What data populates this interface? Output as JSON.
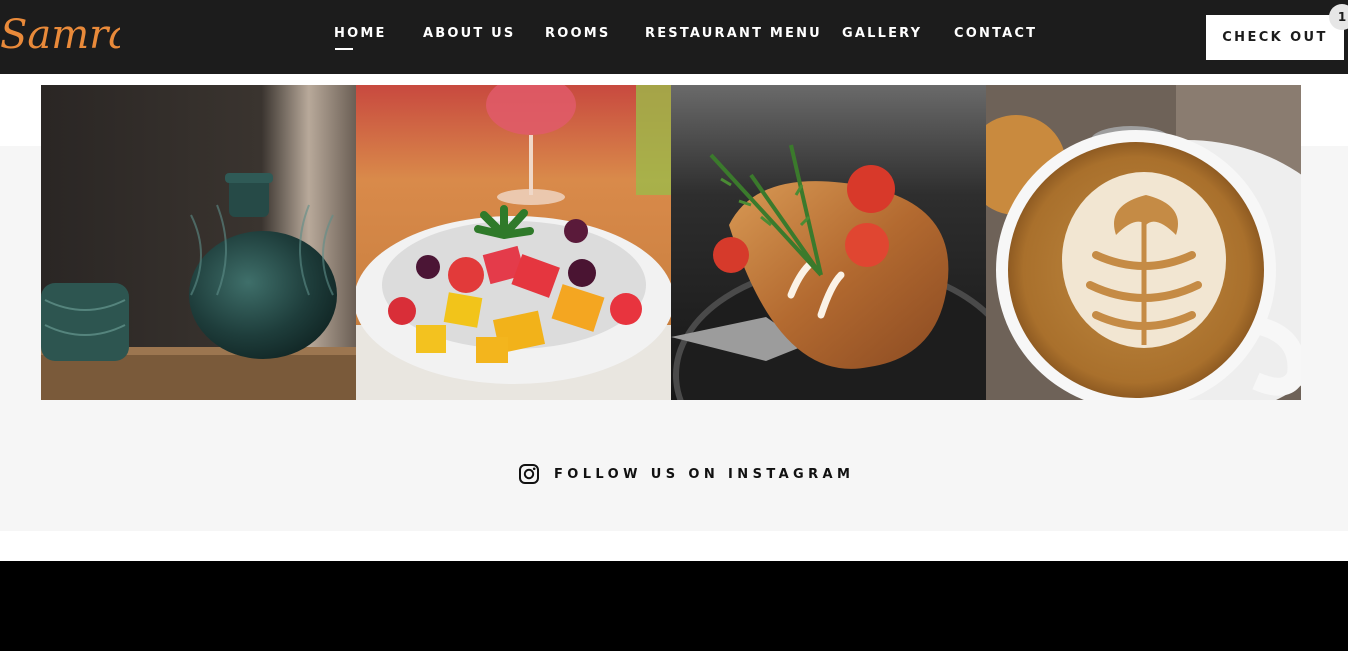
{
  "brand": {
    "logo_text": "Samra",
    "logo_color": "#e98a3a"
  },
  "nav": {
    "items": [
      {
        "label": "HOME",
        "active": true
      },
      {
        "label": "ABOUT US"
      },
      {
        "label": "ROOMS"
      },
      {
        "label": "RESTAURANT MENU"
      },
      {
        "label": "GALLERY"
      },
      {
        "label": "CONTACT"
      }
    ]
  },
  "cart": {
    "button_label": "CHECK OUT",
    "count": "1"
  },
  "instagram": {
    "follow_label": "FOLLOW US ON INSTAGRAM",
    "icon": "instagram-icon",
    "photos": [
      {
        "subject": "glass-vases"
      },
      {
        "subject": "fruit-salad"
      },
      {
        "subject": "grilled-fish"
      },
      {
        "subject": "latte-art"
      }
    ]
  },
  "colors": {
    "header_bg": "#1c1c1c",
    "band_bg": "#f6f6f6",
    "footer_bg": "#000000"
  }
}
